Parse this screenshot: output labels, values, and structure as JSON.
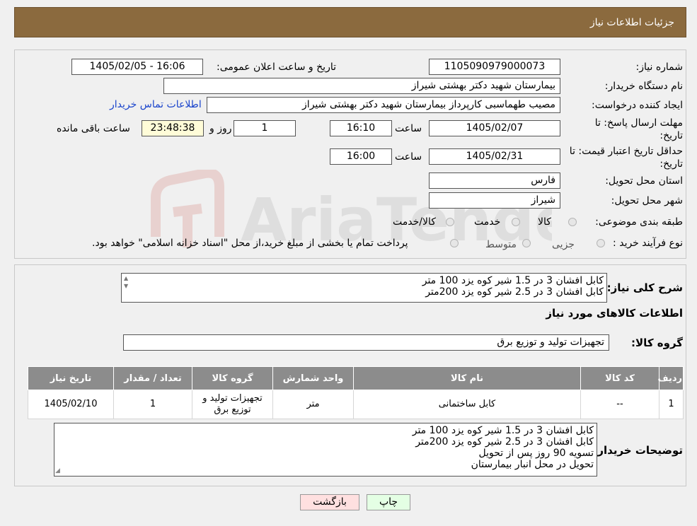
{
  "header": {
    "title": "جزئیات اطلاعات نیاز"
  },
  "form": {
    "need_number_label": "شماره نیاز:",
    "need_number": "1105090979000073",
    "announce_label": "تاریخ و ساعت اعلان عمومی:",
    "announce_value": "1405/02/05 - 16:06",
    "buyer_org_label": "نام دستگاه خریدار:",
    "buyer_org": "بیمارستان شهید دکتر بهشتی شیراز",
    "creator_label": "ایجاد کننده درخواست:",
    "creator": "مصیب طهماسبی کارپرداز بیمارستان شهید دکتر بهشتی شیراز",
    "contact_link": "اطلاعات تماس خریدار",
    "deadline_label_1": "مهلت ارسال پاسخ: تا",
    "deadline_label_2": "تاریخ:",
    "deadline_date": "1405/02/07",
    "time_label": "ساعت",
    "deadline_time": "16:10",
    "days_value": "1",
    "days_label": "روز و",
    "remaining_time": "23:48:38",
    "remaining_label": "ساعت باقی مانده",
    "validity_label_1": "حداقل تاریخ اعتبار قیمت: تا",
    "validity_label_2": "تاریخ:",
    "validity_date": "1405/02/31",
    "validity_time": "16:00",
    "province_label": "استان محل تحویل:",
    "province": "فارس",
    "city_label": "شهر محل تحویل:",
    "city": "شیراز",
    "category_label": "طبقه بندی موضوعی:",
    "category_options": [
      "کالا",
      "خدمت",
      "کالا/خدمت"
    ],
    "process_label": "نوع فرآیند خرید :",
    "process_options": [
      "جزیی",
      "متوسط"
    ],
    "process_note": "پرداخت تمام یا بخشی از مبلغ خرید،از محل \"اسناد خزانه اسلامی\" خواهد بود."
  },
  "details": {
    "summary_label": "شرح کلی نیاز:",
    "summary_lines": [
      "کابل افشان 3 در 1.5 شیر کوه یزد  100 متر",
      "کابل افشان 3 در 2.5 شیر کوه یزد 200متر"
    ],
    "goods_info_title": "اطلاعات کالاهای مورد نیاز",
    "goods_group_label": "گروه کالا:",
    "goods_group": "تجهیزات تولید و توزیع برق",
    "table": {
      "headers": [
        "ردیف",
        "کد کالا",
        "نام کالا",
        "واحد شمارش",
        "گروه کالا",
        "تعداد / مقدار",
        "تاریخ نیاز"
      ],
      "rows": [
        [
          "1",
          "--",
          "کابل ساختمانی",
          "متر",
          "تجهیزات تولید و توزیع برق",
          "1",
          "1405/02/10"
        ]
      ]
    },
    "buyer_notes_label": "توضیحات خریدار:",
    "buyer_notes_lines": [
      "کابل افشان 3 در 1.5 شیر کوه یزد  100 متر",
      "کابل افشان 3 در 2.5 شیر کوه یزد 200متر",
      "تسویه 90 روز پس از تحویل",
      "تحویل در محل انبار بیمارستان"
    ]
  },
  "buttons": {
    "print": "چاپ",
    "back": "بازگشت"
  },
  "colors": {
    "header_bg": "#8b6a3e",
    "table_header_bg": "#8c8c8c",
    "back_btn_bg": "#ffe0e0",
    "print_btn_bg": "#e4ffe4",
    "timer_bg": "#fffcd8"
  }
}
